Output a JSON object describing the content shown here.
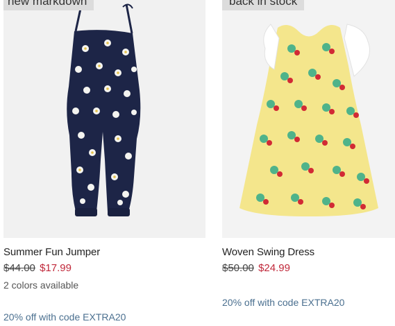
{
  "products": [
    {
      "badge": "new markdown",
      "name": "Summer Fun Jumper",
      "original_price": "$44.00",
      "sale_price": "$17.99",
      "colors_note": "2 colors available",
      "promo": "20% off with code EXTRA20",
      "image_icon": "navy-daisy-jumpsuit-image"
    },
    {
      "badge": "back in stock",
      "name": "Woven Swing Dress",
      "original_price": "$50.00",
      "sale_price": "$24.99",
      "promo": "20% off with code EXTRA20",
      "image_icon": "yellow-strawberry-dress-image"
    }
  ],
  "colors": {
    "sale_price": "#c0283a",
    "promo": "#4a6f8f",
    "badge_bg": "#dcdcdc",
    "jumper_navy": "#1d2547",
    "dress_yellow": "#f4e68c"
  }
}
